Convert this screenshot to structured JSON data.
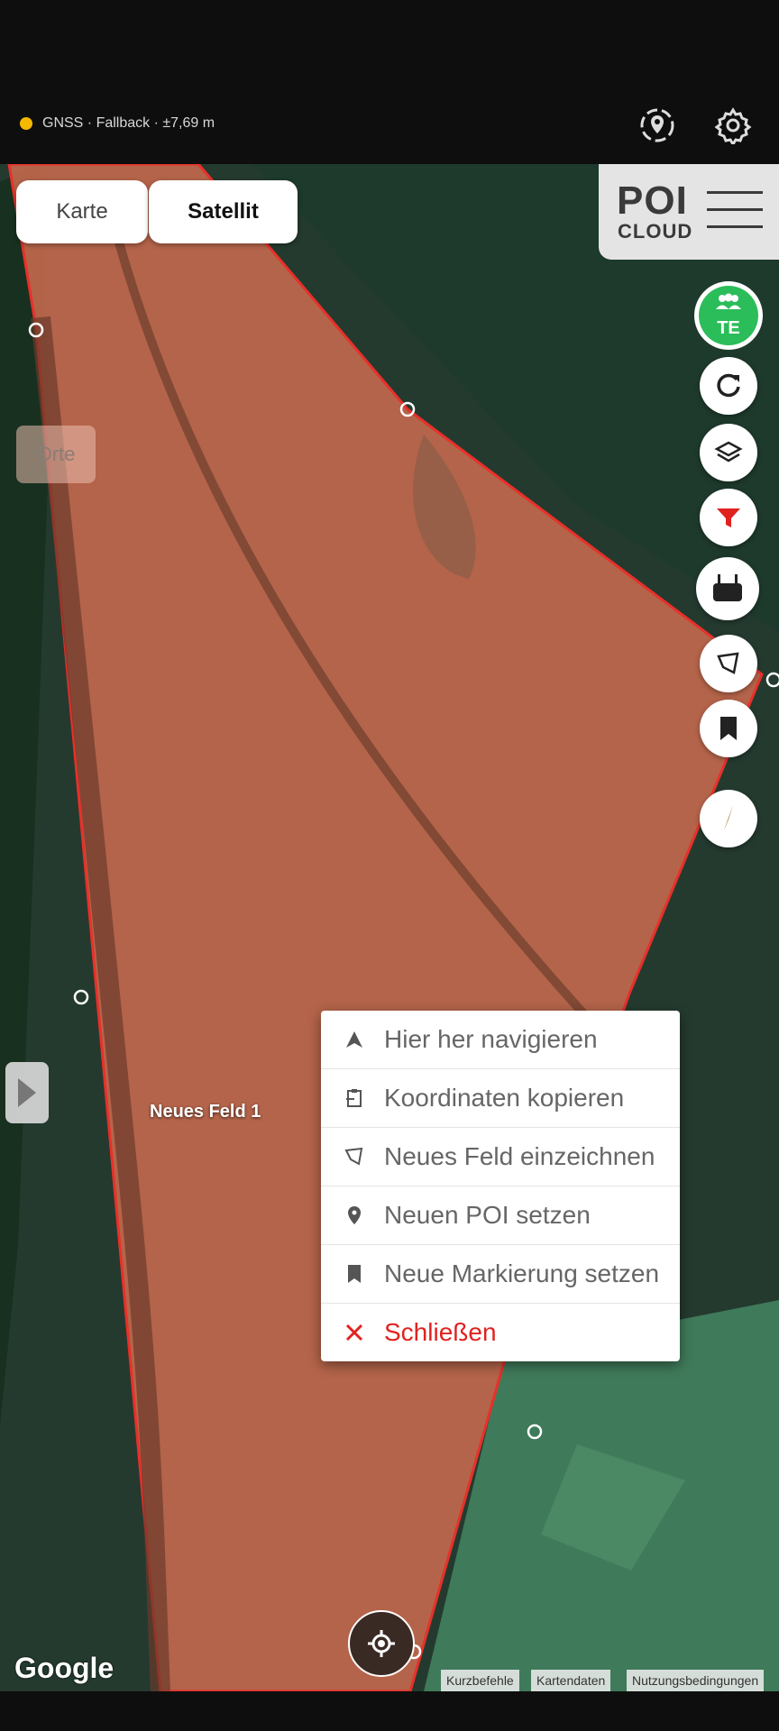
{
  "status": {
    "gnss_text": "GNSS · Fallback · ±7,69 m",
    "indicator_color": "#f5b800"
  },
  "top_icons": [
    "location-target-icon",
    "gear-icon"
  ],
  "map_type": {
    "karte": "Karte",
    "satellit": "Satellit",
    "selected": "Satellit"
  },
  "orte_label": "Orte",
  "logo": {
    "poi": "POI",
    "cloud": "CLOUD"
  },
  "team_badge": "TE",
  "fab_icons": [
    "refresh-icon",
    "layers-icon",
    "filter-icon",
    "controller-icon",
    "polygon-icon",
    "bookmark-icon",
    "compass-icon"
  ],
  "field_label": "Neues Feld 1",
  "context_menu": {
    "items": [
      {
        "label": "Hier her navigieren",
        "icon": "navigation-arrow-icon"
      },
      {
        "label": "Koordinaten kopieren",
        "icon": "clipboard-icon"
      },
      {
        "label": "Neues Feld einzeichnen",
        "icon": "polygon-icon"
      },
      {
        "label": "Neuen POI setzen",
        "icon": "map-pin-icon"
      },
      {
        "label": "Neue Markierung setzen",
        "icon": "bookmark-icon"
      },
      {
        "label": "Schließen",
        "icon": "close-icon"
      }
    ]
  },
  "attribution": {
    "google": "Google",
    "shortcuts": "Kurzbefehle",
    "mapdata": "Kartendaten",
    "terms": "Nutzungsbedingungen"
  },
  "colors": {
    "accent_green": "#2bbd5a",
    "danger_red": "#e0221f",
    "field_fill": "#c86a4f",
    "field_stroke": "#e8302a"
  }
}
